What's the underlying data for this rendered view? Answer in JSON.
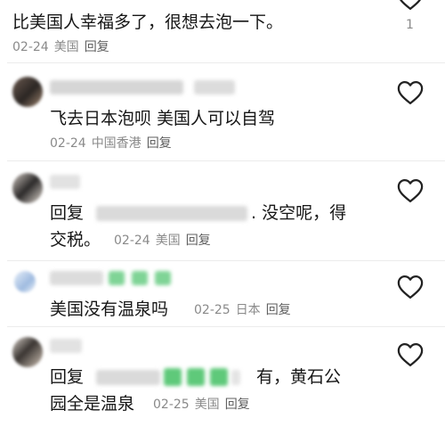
{
  "comments": [
    {
      "text": "比美国人幸福多了，很想去泡一下。",
      "date": "02-24",
      "location": "美国",
      "reply_label": "回复",
      "like_count": "1"
    },
    {
      "text": "飞去日本泡呗 美国人可以自驾",
      "date": "02-24",
      "location": "中国香港",
      "reply_label": "回复"
    },
    {
      "reply_prefix": "回复",
      "text_tail": ". 没空呢，得",
      "text_line2": "交税。",
      "date": "02-24",
      "location": "美国",
      "reply_label": "回复"
    },
    {
      "text": "美国没有温泉吗",
      "date": "02-25",
      "location": "日本",
      "reply_label": "回复"
    },
    {
      "reply_prefix": "回复",
      "text_tail": "有，黄石公",
      "text_line2": "园全是温泉",
      "date": "02-25",
      "location": "美国",
      "reply_label": "回复"
    }
  ],
  "colors": {
    "text": "#161616",
    "meta": "#8a8a8a",
    "heart_stroke": "#222222",
    "divider": "#ececec",
    "emoji_green": "#5fc97a"
  },
  "icons": [
    "heart-icon"
  ]
}
